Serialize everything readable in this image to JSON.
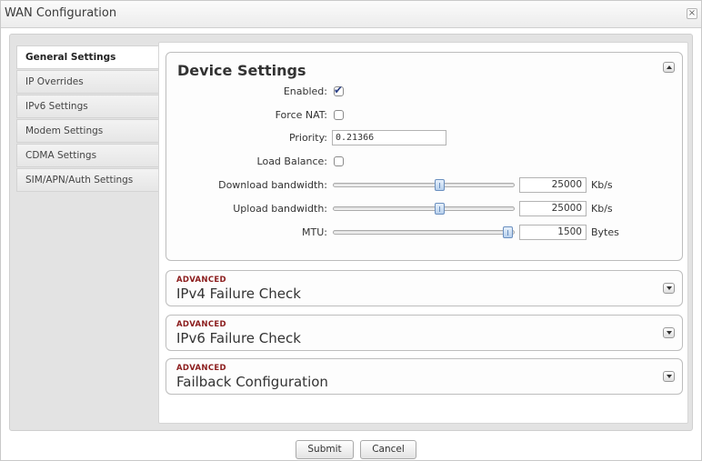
{
  "window": {
    "title": "WAN Configuration",
    "close_glyph": "×"
  },
  "sidebar": {
    "items": [
      {
        "label": "General Settings",
        "active": true
      },
      {
        "label": "IP Overrides",
        "active": false
      },
      {
        "label": "IPv6 Settings",
        "active": false
      },
      {
        "label": "Modem Settings",
        "active": false
      },
      {
        "label": "CDMA Settings",
        "active": false
      },
      {
        "label": "SIM/APN/Auth Settings",
        "active": false
      }
    ]
  },
  "device_settings": {
    "title": "Device Settings",
    "enabled_label": "Enabled:",
    "enabled_checked": true,
    "force_nat_label": "Force NAT:",
    "force_nat_checked": false,
    "priority_label": "Priority:",
    "priority_value": "0.21366",
    "load_balance_label": "Load Balance:",
    "load_balance_checked": false,
    "download_label": "Download bandwidth:",
    "download_value": "25000",
    "download_unit": "Kb/s",
    "download_fraction": 0.6,
    "upload_label": "Upload bandwidth:",
    "upload_value": "25000",
    "upload_unit": "Kb/s",
    "upload_fraction": 0.6,
    "mtu_label": "MTU:",
    "mtu_value": "1500",
    "mtu_unit": "Bytes",
    "mtu_fraction": 1.0
  },
  "advanced_sections": [
    {
      "tag": "ADVANCED",
      "title": "IPv4 Failure Check"
    },
    {
      "tag": "ADVANCED",
      "title": "IPv6 Failure Check"
    },
    {
      "tag": "ADVANCED",
      "title": "Failback Configuration"
    }
  ],
  "footer": {
    "submit_label": "Submit",
    "cancel_label": "Cancel"
  },
  "colors": {
    "advanced_tag": "#8b1c1c",
    "slider_handle": "#b7cfec",
    "checkmark": "#2b3f85"
  }
}
